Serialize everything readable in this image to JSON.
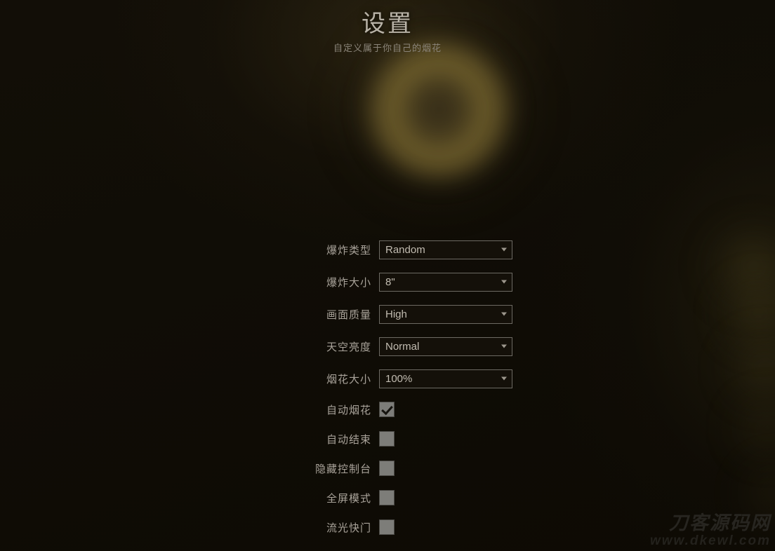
{
  "header": {
    "title": "设置",
    "subtitle": "自定义属于你自己的烟花"
  },
  "settings": {
    "selects": [
      {
        "label": "爆炸类型",
        "value": "Random",
        "arrow_icon": "chevron-down-icon",
        "name": "explosion-type"
      },
      {
        "label": "爆炸大小",
        "value": "8\"",
        "arrow_icon": "chevron-down-icon",
        "name": "explosion-size"
      },
      {
        "label": "画面质量",
        "value": "High",
        "arrow_icon": "chevron-down-icon",
        "name": "render-quality"
      },
      {
        "label": "天空亮度",
        "value": "Normal",
        "arrow_icon": "chevron-down-icon",
        "name": "sky-brightness"
      },
      {
        "label": "烟花大小",
        "value": "100%",
        "arrow_icon": "chevron-down-icon",
        "name": "firework-scale"
      }
    ],
    "checkboxes": [
      {
        "label": "自动烟花",
        "checked": true,
        "name": "auto-firework"
      },
      {
        "label": "自动结束",
        "checked": false,
        "name": "auto-finale"
      },
      {
        "label": "隐藏控制台",
        "checked": false,
        "name": "hide-controls"
      },
      {
        "label": "全屏模式",
        "checked": false,
        "name": "fullscreen-mode"
      },
      {
        "label": "流光快门",
        "checked": false,
        "name": "long-exposure"
      }
    ]
  },
  "scene": {
    "burst_icon": "firework-burst-glow",
    "burst_color": "#837034",
    "background_color": "#0e0b05",
    "accent_color": "#b9b3a8"
  },
  "watermark": {
    "title": "刀客源码网",
    "url": "www.dkewl.com"
  }
}
